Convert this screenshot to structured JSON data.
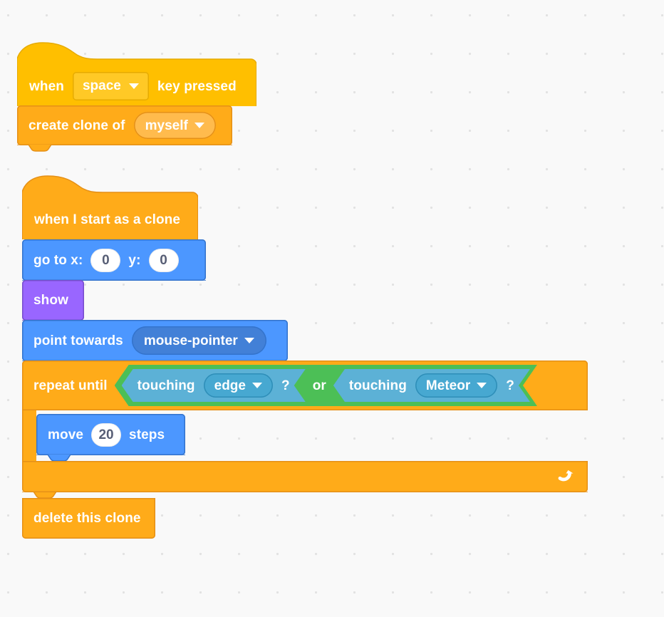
{
  "workspace": {
    "background_color": "#f9f9f9",
    "grid_dot_color": "#e2e2e2"
  },
  "palette": {
    "events_yellow": "#ffbf00",
    "events_yellow_border": "#e6ab00",
    "control_orange": "#ffab19",
    "control_orange_border": "#e59017",
    "motion_blue": "#4c97ff",
    "motion_blue_border": "#3373cc",
    "motion_input": "#4280d7",
    "looks_purple": "#9966ff",
    "looks_purple_border": "#774dcb",
    "sensing_blue": "#5cb1d6",
    "sensing_blue_border": "#2e8eb8",
    "sensing_input": "#47a8d1",
    "operators_green": "#4cbf56",
    "operators_green_border": "#389438",
    "text_white": "#ffffff",
    "input_text": "#575e75"
  },
  "scripts": [
    {
      "id": "script-1",
      "name": "when-space-key-pressed-script",
      "blocks": [
        {
          "id": "when-key-pressed",
          "type": "hat",
          "category": "events",
          "text_before": "when",
          "text_after": "key pressed",
          "dropdown": {
            "name": "key-dropdown",
            "value": "space",
            "icon": "chevron-down-icon"
          }
        },
        {
          "id": "create-clone-of",
          "type": "stack",
          "category": "control",
          "text_before": "create clone of",
          "dropdown": {
            "name": "clone-target-dropdown",
            "value": "myself",
            "icon": "chevron-down-icon"
          }
        }
      ]
    },
    {
      "id": "script-2",
      "name": "when-i-start-as-a-clone-script",
      "blocks": [
        {
          "id": "when-i-start-as-a-clone",
          "type": "hat",
          "category": "control",
          "label": "when I start as a clone"
        },
        {
          "id": "go-to-xy",
          "type": "stack",
          "category": "motion",
          "text_x_label": "go to x:",
          "x_value": "0",
          "text_y_label": "y:",
          "y_value": "0"
        },
        {
          "id": "show",
          "type": "stack",
          "category": "looks",
          "label": "show"
        },
        {
          "id": "point-towards",
          "type": "stack",
          "category": "motion",
          "text_before": "point towards",
          "dropdown": {
            "name": "point-towards-dropdown",
            "value": "mouse-pointer",
            "icon": "chevron-down-icon"
          }
        },
        {
          "id": "repeat-until",
          "type": "c-block",
          "category": "control",
          "label": "repeat until",
          "loop_icon": "loop-arrow-icon",
          "condition": {
            "id": "or-operator",
            "type": "boolean",
            "category": "operators",
            "operator_label": "or",
            "operands": [
              {
                "id": "touching-edge",
                "type": "boolean",
                "category": "sensing",
                "text_before": "touching",
                "text_after": "?",
                "dropdown": {
                  "name": "touching-edge-dropdown",
                  "value": "edge",
                  "icon": "chevron-down-icon"
                }
              },
              {
                "id": "touching-meteor",
                "type": "boolean",
                "category": "sensing",
                "text_before": "touching",
                "text_after": "?",
                "dropdown": {
                  "name": "touching-meteor-dropdown",
                  "value": "Meteor",
                  "icon": "chevron-down-icon"
                }
              }
            ]
          },
          "substack": [
            {
              "id": "move-steps",
              "type": "stack",
              "category": "motion",
              "text_before": "move",
              "value": "20",
              "text_after": "steps"
            }
          ]
        },
        {
          "id": "delete-this-clone",
          "type": "cap",
          "category": "control",
          "label": "delete this clone"
        }
      ]
    }
  ]
}
